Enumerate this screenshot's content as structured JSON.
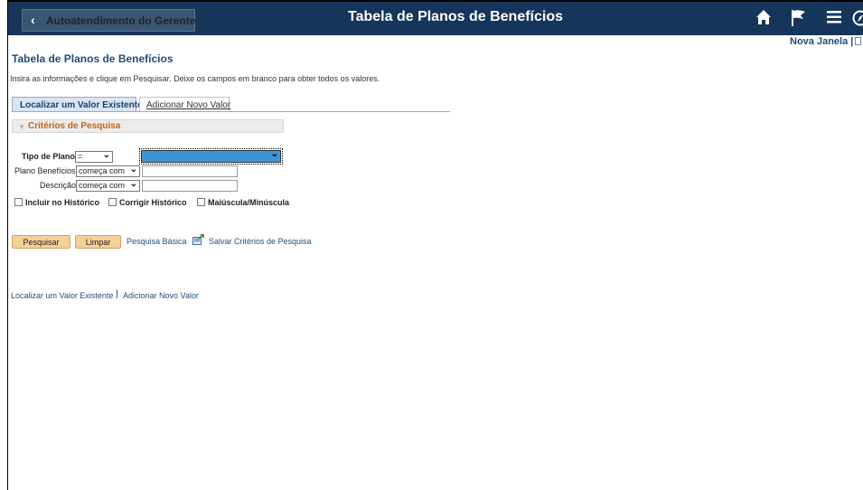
{
  "header": {
    "back_label": "Autoatendimento do Gerente",
    "title": "Tabela de Planos de Benefícios",
    "icons": [
      "home-icon",
      "flag-icon",
      "menu-icon",
      "navbar-icon"
    ]
  },
  "new_window": "Nova Janela |",
  "page": {
    "title": "Tabela de Planos de Benefícios",
    "instructions": "Insira as informações e clique em Pesquisar. Deixe os campos em branco para obter todos os valores."
  },
  "tabs": [
    {
      "label": "Localizar um Valor Existente",
      "active": true
    },
    {
      "label": "Adicionar Novo Valor",
      "active": false
    }
  ],
  "section": {
    "title": "Critérios de Pesquisa"
  },
  "fields": {
    "tipo_plano": {
      "label": "Tipo de Plano",
      "operator": "=",
      "value": ""
    },
    "plano_beneficios": {
      "label": "Plano Benefícios",
      "operator": "começa com",
      "value": ""
    },
    "descricao": {
      "label": "Descrição",
      "operator": "começa com",
      "value": ""
    }
  },
  "checkboxes": [
    {
      "label": "Incluir no Histórico",
      "checked": false
    },
    {
      "label": "Corrigir Histórico",
      "checked": false
    },
    {
      "label": "Maiúscula/Minúscula",
      "checked": false
    }
  ],
  "buttons": {
    "search": "Pesquisar",
    "clear": "Limpar"
  },
  "links": {
    "basic_search": "Pesquisa Básica",
    "save_criteria": "Salvar Critérios de Pesquisa",
    "find_existing": "Localizar um Valor Existente",
    "add_new": "Adicionar Novo Valor"
  },
  "colors": {
    "banner": "#16355a",
    "link": "#1f4d7a",
    "section_title": "#c0651a",
    "button": "#f5cf98",
    "selected_dropdown": "#3c94d8"
  }
}
